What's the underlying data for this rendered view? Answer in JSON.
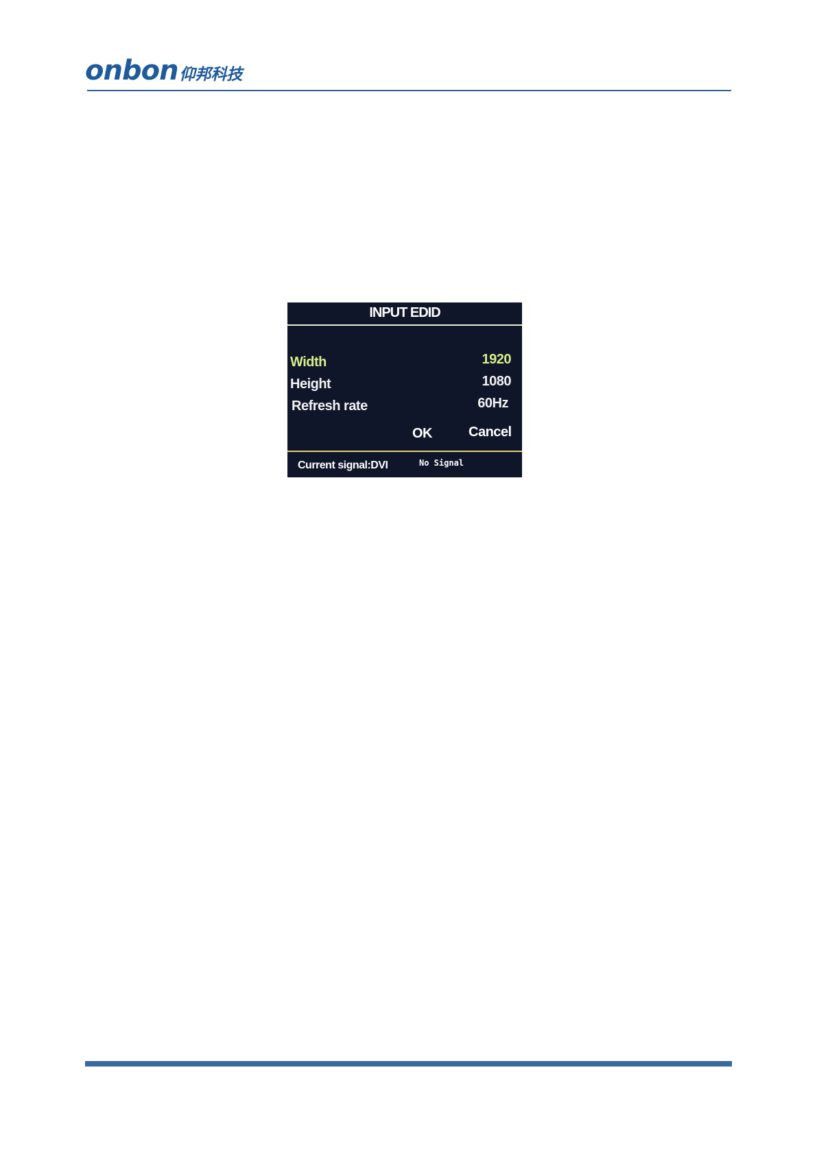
{
  "header": {
    "logo_text": "onbon",
    "logo_cn": "仰邦科技"
  },
  "screen": {
    "title": "INPUT EDID",
    "rows": [
      {
        "label": "Width",
        "value": "1920",
        "selected": true
      },
      {
        "label": "Height",
        "value": "1080",
        "selected": false
      },
      {
        "label": "Refresh rate",
        "value": "60Hz",
        "selected": false
      }
    ],
    "buttons": {
      "ok": "OK",
      "cancel": "Cancel"
    },
    "status": {
      "current_signal": "Current signal:DVI",
      "signal_state": "No Signal"
    },
    "colors": {
      "background": "#10162a",
      "highlight": "#d8ef8a",
      "text": "#f2f2f2"
    }
  },
  "theme": {
    "brand_color": "#1f5a9a",
    "rule_color": "#3a689e"
  }
}
